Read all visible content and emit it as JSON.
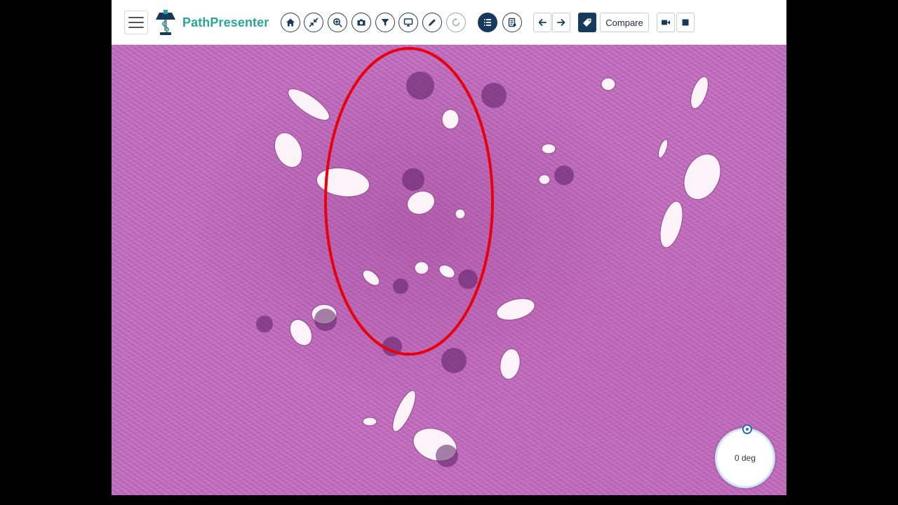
{
  "app": {
    "brand": "PathPresenter",
    "colors": {
      "brand": "#2aa59c",
      "toolbar_dark": "#163a5c",
      "annotation": "#e8000d",
      "stain": "#c575c2"
    }
  },
  "toolbar": {
    "menu_icon": "hamburger-icon",
    "buttons": [
      {
        "name": "home",
        "icon": "home-icon"
      },
      {
        "name": "fit-screen",
        "icon": "collapse-arrows-icon"
      },
      {
        "name": "zoom",
        "icon": "zoom-icon"
      },
      {
        "name": "screenshot",
        "icon": "camera-icon"
      },
      {
        "name": "filter",
        "icon": "filter-icon"
      },
      {
        "name": "present",
        "icon": "monitor-icon"
      },
      {
        "name": "annotate",
        "icon": "pen-icon"
      },
      {
        "name": "rotate",
        "icon": "rotate-icon"
      },
      {
        "name": "annotation-list",
        "icon": "list-icon"
      },
      {
        "name": "report",
        "icon": "report-icon"
      }
    ],
    "nav": {
      "prev_icon": "arrow-left-icon",
      "next_icon": "arrow-right-icon"
    },
    "tag_icon": "tag-icon",
    "compare_label": "Compare",
    "record_icon": "video-camera-icon",
    "stop_icon": "stop-icon"
  },
  "viewer": {
    "annotation_shape": "ellipse",
    "rotation_label": "0 deg"
  }
}
